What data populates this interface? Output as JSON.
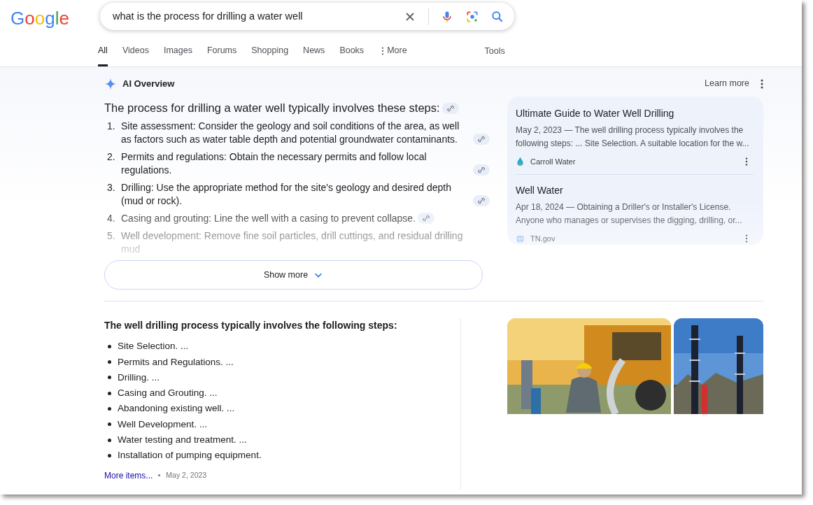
{
  "logo": "Google",
  "search": {
    "query": "what is the process for drilling a water well"
  },
  "tabs": [
    {
      "label": "All",
      "selected": true,
      "kind": "tab"
    },
    {
      "label": "Videos",
      "selected": false,
      "kind": "tab"
    },
    {
      "label": "Images",
      "selected": false,
      "kind": "tab"
    },
    {
      "label": "Forums",
      "selected": false,
      "kind": "tab"
    },
    {
      "label": "Shopping",
      "selected": false,
      "kind": "tab"
    },
    {
      "label": "News",
      "selected": false,
      "kind": "tab"
    },
    {
      "label": "Books",
      "selected": false,
      "kind": "tab"
    },
    {
      "label": "More",
      "selected": false,
      "kind": "menu"
    }
  ],
  "tools": "Tools",
  "ai_overview": {
    "title": "AI Overview",
    "learn_more": "Learn more",
    "heading": "The process for drilling a water well typically involves these steps:",
    "steps": [
      {
        "number": "1.",
        "text": "Site assessment: Consider the geology and soil conditions of the area, as well as factors such as water table depth and potential groundwater contaminants."
      },
      {
        "number": "2.",
        "text": "Permits and regulations: Obtain the necessary permits and follow local regulations."
      },
      {
        "number": "3.",
        "text": "Drilling: Use the appropriate method for the site's geology and desired depth (mud or rock)."
      },
      {
        "number": "4.",
        "text": "Casing and grouting: Line the well with a casing to prevent collapse."
      },
      {
        "number": "5.",
        "text": "Well development: Remove fine soil particles, drill cuttings, and residual drilling mud"
      }
    ],
    "show_more": "Show more",
    "sources": [
      {
        "title": "Ultimate Guide to Water Well Drilling",
        "snippet": "May 2, 2023 — The well drilling process typically involves the following steps: ... Site Selection. A suitable location for the w...",
        "site": "Carroll Water",
        "kind": "drop"
      },
      {
        "title": "Well Water",
        "snippet": "Apr 18, 2024 — Obtaining a Driller's or Installer's License. Anyone who manages or supervises the digging, drilling, or...",
        "site": "TN.gov",
        "kind": "globe"
      }
    ]
  },
  "featured_snippet": {
    "heading": "The well drilling process typically involves the following steps:",
    "items": [
      "Site Selection. ...",
      "Permits and Regulations. ...",
      "Drilling. ...",
      "Casing and Grouting. ...",
      "Abandoning existing well. ...",
      "Well Development. ...",
      "Water testing and treatment. ...",
      "Installation of pumping equipment."
    ],
    "more_link": "More items...",
    "date": "May 2, 2023"
  }
}
